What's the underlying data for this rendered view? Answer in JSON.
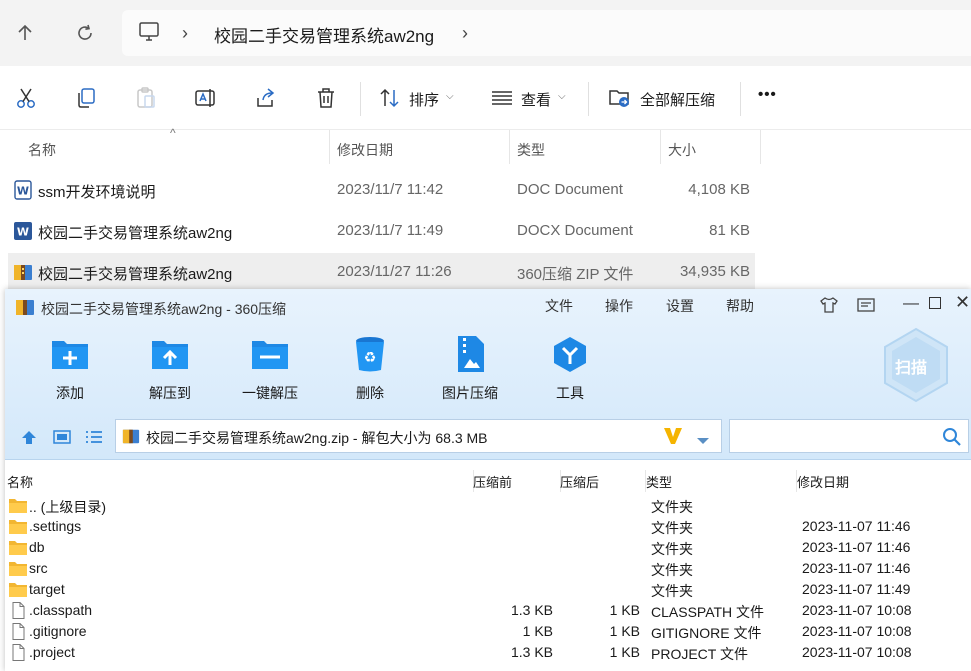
{
  "explorer": {
    "breadcrumb": [
      "校园二手交易管理系统aw2ng"
    ],
    "toolbar": {
      "sort_label": "排序",
      "view_label": "查看",
      "extract_all_label": "全部解压缩",
      "more_label": "•••"
    },
    "columns": [
      "名称",
      "修改日期",
      "类型",
      "大小"
    ],
    "files": [
      {
        "name": "ssm开发环境说明",
        "date": "2023/11/7 11:42",
        "type": "DOC Document",
        "size": "4,108 KB",
        "icon": "word-doc-icon"
      },
      {
        "name": "校园二手交易管理系统aw2ng",
        "date": "2023/11/7 11:49",
        "type": "DOCX Document",
        "size": "81 KB",
        "icon": "word-docx-icon"
      },
      {
        "name": "校园二手交易管理系统aw2ng",
        "date": "2023/11/27 11:26",
        "type": "360压缩 ZIP 文件",
        "size": "34,935 KB",
        "icon": "zip-archive-icon",
        "selected": true
      }
    ]
  },
  "zip": {
    "title": "校园二手交易管理系统aw2ng - 360压缩",
    "menu": [
      "文件",
      "操作",
      "设置",
      "帮助"
    ],
    "buttons": [
      "添加",
      "解压到",
      "一键解压",
      "删除",
      "图片压缩",
      "工具"
    ],
    "scan_label": "扫描",
    "address": "校园二手交易管理系统aw2ng.zip - 解包大小为 68.3 MB",
    "columns": [
      "名称",
      "压缩前",
      "压缩后",
      "类型",
      "修改日期"
    ],
    "rows": [
      {
        "name": ".. (上级目录)",
        "before": "",
        "after": "",
        "type": "文件夹",
        "date": "",
        "kind": "folder"
      },
      {
        "name": ".settings",
        "before": "",
        "after": "",
        "type": "文件夹",
        "date": "2023-11-07 11:46",
        "kind": "folder"
      },
      {
        "name": "db",
        "before": "",
        "after": "",
        "type": "文件夹",
        "date": "2023-11-07 11:46",
        "kind": "folder"
      },
      {
        "name": "src",
        "before": "",
        "after": "",
        "type": "文件夹",
        "date": "2023-11-07 11:46",
        "kind": "folder"
      },
      {
        "name": "target",
        "before": "",
        "after": "",
        "type": "文件夹",
        "date": "2023-11-07 11:49",
        "kind": "folder"
      },
      {
        "name": ".classpath",
        "before": "1.3 KB",
        "after": "1 KB",
        "type": "CLASSPATH 文件",
        "date": "2023-11-07 10:08",
        "kind": "file"
      },
      {
        "name": ".gitignore",
        "before": "1 KB",
        "after": "1 KB",
        "type": "GITIGNORE 文件",
        "date": "2023-11-07 10:08",
        "kind": "file"
      },
      {
        "name": ".project",
        "before": "1.3 KB",
        "after": "1 KB",
        "type": "PROJECT 文件",
        "date": "2023-11-07 10:08",
        "kind": "file"
      }
    ]
  }
}
